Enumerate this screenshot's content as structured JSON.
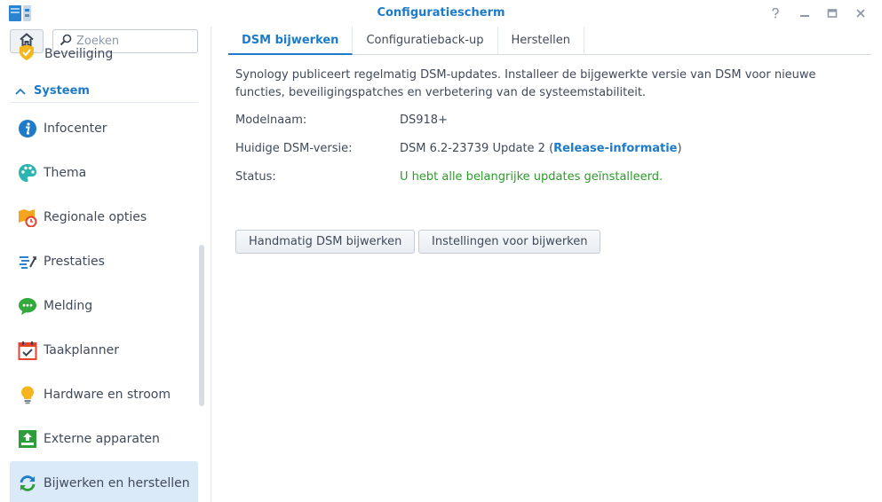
{
  "window": {
    "title": "Configuratiescherm",
    "buttons": [
      "help-icon",
      "minimize-icon",
      "maximize-icon",
      "close-icon"
    ]
  },
  "sidebar": {
    "search_placeholder": "Zoeken",
    "cut_item_label": "Beveiliging",
    "section_label": "Systeem",
    "items": [
      {
        "label": "Infocenter",
        "icon": "info-icon"
      },
      {
        "label": "Thema",
        "icon": "palette-icon"
      },
      {
        "label": "Regionale opties",
        "icon": "region-clock-icon"
      },
      {
        "label": "Prestaties",
        "icon": "performance-icon"
      },
      {
        "label": "Melding",
        "icon": "chat-bubble-icon"
      },
      {
        "label": "Taakplanner",
        "icon": "calendar-check-icon"
      },
      {
        "label": "Hardware en stroom",
        "icon": "lightbulb-icon"
      },
      {
        "label": "Externe apparaten",
        "icon": "external-device-icon"
      },
      {
        "label": "Bijwerken en herstellen",
        "icon": "refresh-icon",
        "active": true
      }
    ]
  },
  "tabs": [
    {
      "label": "DSM bijwerken",
      "active": true
    },
    {
      "label": "Configuratieback-up"
    },
    {
      "label": "Herstellen"
    }
  ],
  "content": {
    "description": "Synology publiceert regelmatig DSM-updates. Installeer de bijgewerkte versie van DSM voor nieuwe functies, beveiligingspatches en verbetering van de systeemstabiliteit.",
    "model_label": "Modelnaam:",
    "model_value": "DS918+",
    "version_label": "Huidige DSM-versie:",
    "version_value": "DSM 6.2-23739 Update 2 (",
    "version_link": "Release-informatie",
    "version_close": ")",
    "status_label": "Status:",
    "status_value": "U hebt alle belangrijke updates geïnstalleerd.",
    "manual_update_button": "Handmatig DSM bijwerken",
    "update_settings_button": "Instellingen voor bijwerken"
  },
  "colors": {
    "accent": "#1d7bc9",
    "status_ok": "#2b9c2a",
    "active_item_bg": "#daeaf8"
  }
}
